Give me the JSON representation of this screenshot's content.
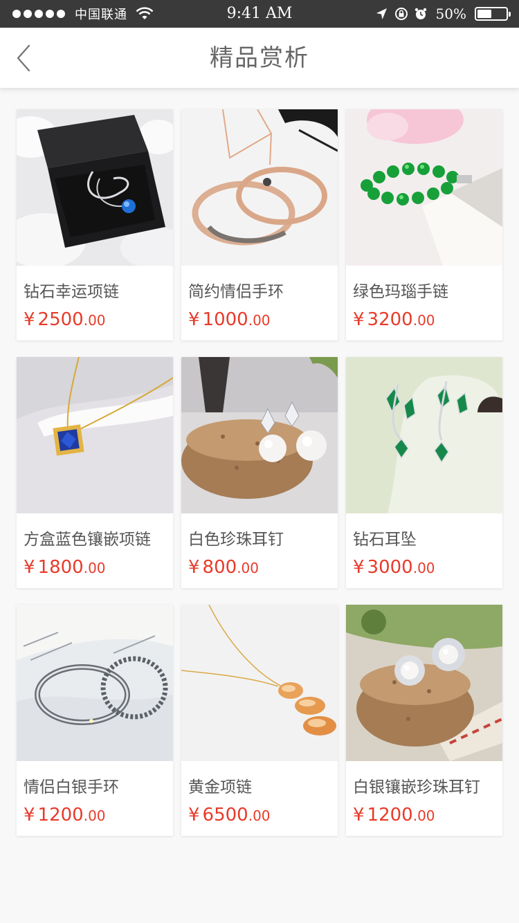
{
  "status_bar": {
    "carrier": "中国联通",
    "time": "9:41 AM",
    "battery_percent": "50%",
    "battery_level": 0.5
  },
  "nav": {
    "title": "精品赏析"
  },
  "colors": {
    "price": "#e83a2a",
    "status_bar_bg": "#3a3a3a"
  },
  "products": [
    {
      "name": "钻石幸运项链",
      "currency": "¥",
      "price_int": "2500",
      "price_dec": ".00",
      "image": "diamond-necklace-in-black-box"
    },
    {
      "name": "简约情侣手环",
      "currency": "¥",
      "price_int": "1000",
      "price_dec": ".00",
      "image": "rose-gold-bangles"
    },
    {
      "name": "绿色玛瑙手链",
      "currency": "¥",
      "price_int": "3200",
      "price_dec": ".00",
      "image": "green-agate-bracelet"
    },
    {
      "name": "方盒蓝色镶嵌项链",
      "currency": "¥",
      "price_int": "1800",
      "price_dec": ".00",
      "image": "blue-square-pendant-necklace"
    },
    {
      "name": "白色珍珠耳钉",
      "currency": "¥",
      "price_int": "800",
      "price_dec": ".00",
      "image": "pearl-stud-earrings-on-cork"
    },
    {
      "name": "钻石耳坠",
      "currency": "¥",
      "price_int": "3000",
      "price_dec": ".00",
      "image": "emerald-diamond-drop-earrings"
    },
    {
      "name": "情侣白银手环",
      "currency": "¥",
      "price_int": "1200",
      "price_dec": ".00",
      "image": "silver-couple-bangles"
    },
    {
      "name": "黄金项链",
      "currency": "¥",
      "price_int": "6500",
      "price_dec": ".00",
      "image": "gold-leaf-pendant-necklace"
    },
    {
      "name": "白银镶嵌珍珠耳钉",
      "currency": "¥",
      "price_int": "1200",
      "price_dec": ".00",
      "image": "silver-pearl-flower-earrings"
    }
  ]
}
